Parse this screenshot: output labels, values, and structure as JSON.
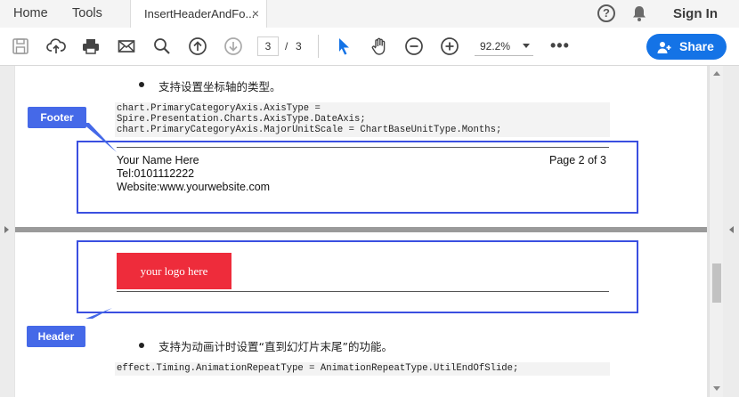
{
  "menubar": {
    "home": "Home",
    "tools": "Tools",
    "tab_title": "InsertHeaderAndFo...",
    "tab_close": "×",
    "help": "?",
    "sign_in": "Sign In"
  },
  "toolbar": {
    "icons": [
      "save-icon",
      "upload-icon",
      "print-icon",
      "mail-icon",
      "search-icon",
      "page-up-icon",
      "page-down-icon",
      "select-cursor-icon",
      "hand-icon",
      "zoom-out-icon",
      "zoom-in-icon",
      "more-icon"
    ],
    "page_current": "3",
    "page_separator": "/",
    "page_total": "3",
    "zoom": "92.2%",
    "more": "•••",
    "share_label": "Share"
  },
  "colors": {
    "accent": "#1473e6",
    "callout_border": "#3a4fe0",
    "callout_label": "#4569e8",
    "logo_bg": "#ee2c3b"
  },
  "doc": {
    "bullet1": "支持设置坐标轴的类型。",
    "code1": "chart.PrimaryCategoryAxis.AxisType =\nSpire.Presentation.Charts.AxisType.DateAxis;\nchart.PrimaryCategoryAxis.MajorUnitScale = ChartBaseUnitType.Months;",
    "footer_callout": "Footer",
    "footer": {
      "name": "Your Name Here",
      "page": "Page 2 of 3",
      "tel": "Tel:0101112222",
      "website": "Website:www.yourwebsite.com"
    },
    "header_callout": "Header",
    "logo_text": "your logo here",
    "bullet2": "支持为动画计时设置“直到幻灯片末尾”的功能。",
    "code2": "effect.Timing.AnimationRepeatType = AnimationRepeatType.UtilEndOfSlide;"
  }
}
